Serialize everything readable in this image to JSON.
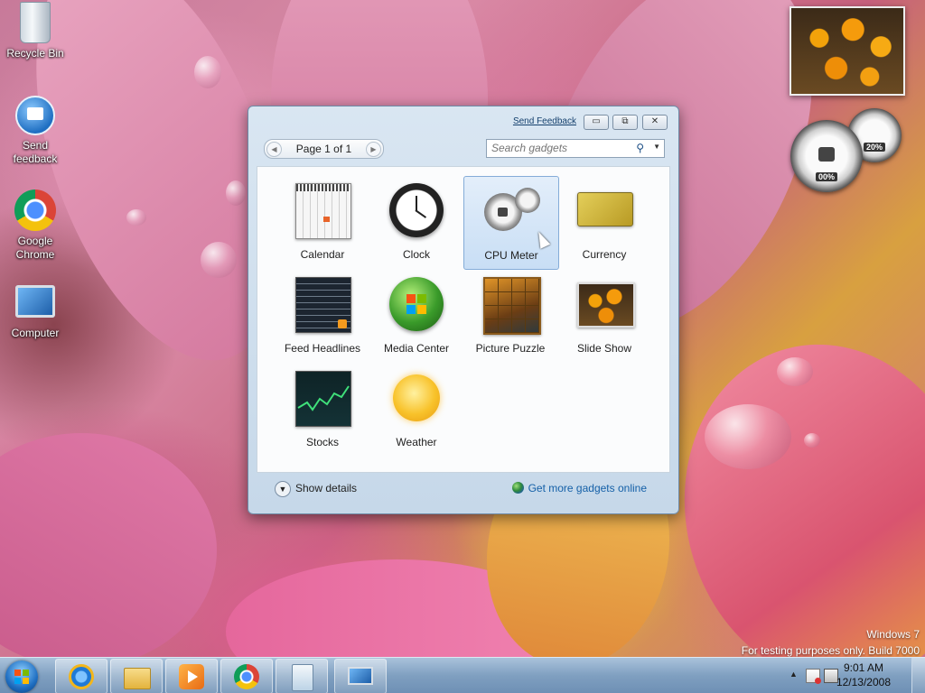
{
  "desktop": {
    "icons": [
      {
        "label": "Recycle Bin",
        "icon": "recycle-bin-icon"
      },
      {
        "label": "Send feedback",
        "icon": "send-feedback-icon"
      },
      {
        "label": "Google Chrome",
        "icon": "chrome-icon"
      },
      {
        "label": "Computer",
        "icon": "computer-icon"
      }
    ],
    "gadgets": {
      "cpu_meter_cpu_pct": "00%",
      "cpu_meter_memory_pct": "20%"
    },
    "watermark": {
      "line1": "Windows 7",
      "line2": "For testing purposes only. Build 7000"
    }
  },
  "gallery": {
    "send_feedback": "Send Feedback",
    "window_buttons": {
      "minimize": "▭",
      "restore": "⧉",
      "close": "✕"
    },
    "pager": {
      "label": "Page 1 of 1"
    },
    "search": {
      "placeholder": "Search gadgets"
    },
    "gadgets": [
      {
        "name": "Calendar",
        "selected": false
      },
      {
        "name": "Clock",
        "selected": false
      },
      {
        "name": "CPU Meter",
        "selected": true
      },
      {
        "name": "Currency",
        "selected": false
      },
      {
        "name": "Feed Headlines",
        "selected": false
      },
      {
        "name": "Media Center",
        "selected": false
      },
      {
        "name": "Picture Puzzle",
        "selected": false
      },
      {
        "name": "Slide Show",
        "selected": false
      },
      {
        "name": "Stocks",
        "selected": false
      },
      {
        "name": "Weather",
        "selected": false
      }
    ],
    "footer": {
      "show_details": "Show details",
      "get_more": "Get more gadgets online"
    }
  },
  "taskbar": {
    "clock_time": "9:01 AM",
    "clock_date": "12/13/2008",
    "tray_up": "▲"
  },
  "colors": {
    "link": "#1560a8",
    "selection": "#c8def5",
    "taskbar": "#7f9fc0"
  }
}
